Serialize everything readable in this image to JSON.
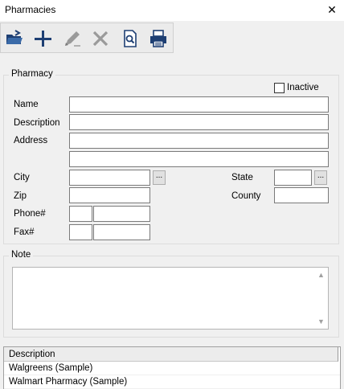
{
  "window": {
    "title": "Pharmacies",
    "close_glyph": "✕"
  },
  "toolbar": {
    "buttons": [
      {
        "icon": "open-folder-icon",
        "enabled": true
      },
      {
        "icon": "plus-icon",
        "enabled": true
      },
      {
        "icon": "pencil-icon",
        "enabled": false
      },
      {
        "icon": "delete-x-icon",
        "enabled": false
      },
      {
        "icon": "preview-icon",
        "enabled": true
      },
      {
        "icon": "printer-icon",
        "enabled": true
      }
    ]
  },
  "pharmacy": {
    "legend": "Pharmacy",
    "inactive_label": "Inactive",
    "inactive_checked": false,
    "labels": {
      "name": "Name",
      "description": "Description",
      "address": "Address",
      "city": "City",
      "state": "State",
      "zip": "Zip",
      "county": "County",
      "phone": "Phone#",
      "fax": "Fax#"
    },
    "values": {
      "name": "",
      "description": "",
      "address1": "",
      "address2": "",
      "city": "",
      "state": "",
      "zip": "",
      "county": "",
      "phone_area": "",
      "phone_number": "",
      "fax_area": "",
      "fax_number": ""
    },
    "ellipsis": "..."
  },
  "note": {
    "legend": "Note",
    "value": ""
  },
  "grid": {
    "header": "Description",
    "rows": [
      "Walgreens (Sample)",
      "Walmart Pharmacy (Sample)"
    ]
  },
  "colors": {
    "toolbar_icon_blue": "#1e3f73",
    "disabled_gray": "#9a9a9a"
  }
}
